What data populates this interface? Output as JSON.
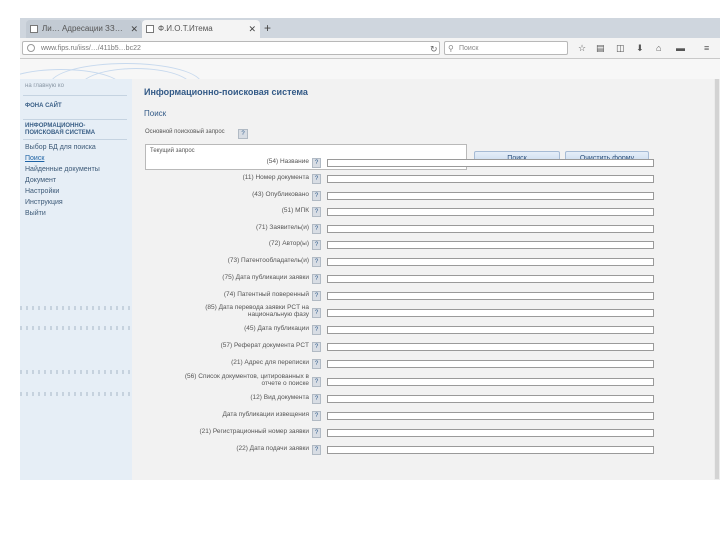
{
  "browser": {
    "tabs": [
      {
        "label": "Ли… Адресации ЗЗ…",
        "active": false
      },
      {
        "label": "Ф.И.О.Т.Итема",
        "active": true
      }
    ],
    "new_tab_icon": "plus",
    "url": "www.fips.ru/iiss/…/411b5…bc22",
    "search_placeholder": "Поиск",
    "toolbar_icons": [
      "star-icon",
      "bookmark-icon",
      "pocket-icon",
      "download-icon",
      "home-icon",
      "chat-icon",
      "menu-icon"
    ]
  },
  "sidebar": {
    "top_link": "на главную ко",
    "section1_header": "ФОНА САЙТ",
    "section2_header_line1": "ИНФОРМАЦИОННО-",
    "section2_header_line2": "ПОИСКОВАЯ СИСТЕМА",
    "items": [
      {
        "label": "Выбор БД для поиска",
        "current": false
      },
      {
        "label": "Поиск",
        "current": true
      },
      {
        "label": "Найденные документы",
        "current": false
      },
      {
        "label": "Документ",
        "current": false
      },
      {
        "label": "Настройки",
        "current": false
      },
      {
        "label": "Инструкция",
        "current": false
      },
      {
        "label": "Выйти",
        "current": false
      }
    ]
  },
  "main": {
    "title": "Информационно-поисковая система",
    "subtitle": "Поиск",
    "query_label": "Основной поисковый запрос",
    "help_glyph": "?",
    "query_value": "Текущий запрос",
    "search_button": "Поиск",
    "clear_button": "Очистить форму",
    "fields": [
      {
        "label": "(54) Название"
      },
      {
        "label": "(11) Номер документа"
      },
      {
        "label": "(43) Опубликовано"
      },
      {
        "label": "(51) МПК"
      },
      {
        "label": "(71) Заявитель(и)"
      },
      {
        "label": "(72) Автор(ы)"
      },
      {
        "label": "(73) Патентообладатель(и)"
      },
      {
        "label": "(75) Дата публикации заявки"
      },
      {
        "label": "(74) Патентный поверенный"
      },
      {
        "label": "(85) Дата перевода заявки PCT на",
        "label2": "национальную фазу"
      },
      {
        "label": "(45) Дата публикации"
      },
      {
        "label": "(57) Реферат документа PCT"
      },
      {
        "label": "(21) Адрес для переписки"
      },
      {
        "label": "(56) Список документов, цитированных в",
        "label2": "отчете о поиске"
      },
      {
        "label": "(12) Вид документа"
      },
      {
        "label": "Дата публикации извещения"
      },
      {
        "label": "(21) Регистрационный номер заявки"
      },
      {
        "label": "(22) Дата подачи заявки"
      }
    ]
  }
}
